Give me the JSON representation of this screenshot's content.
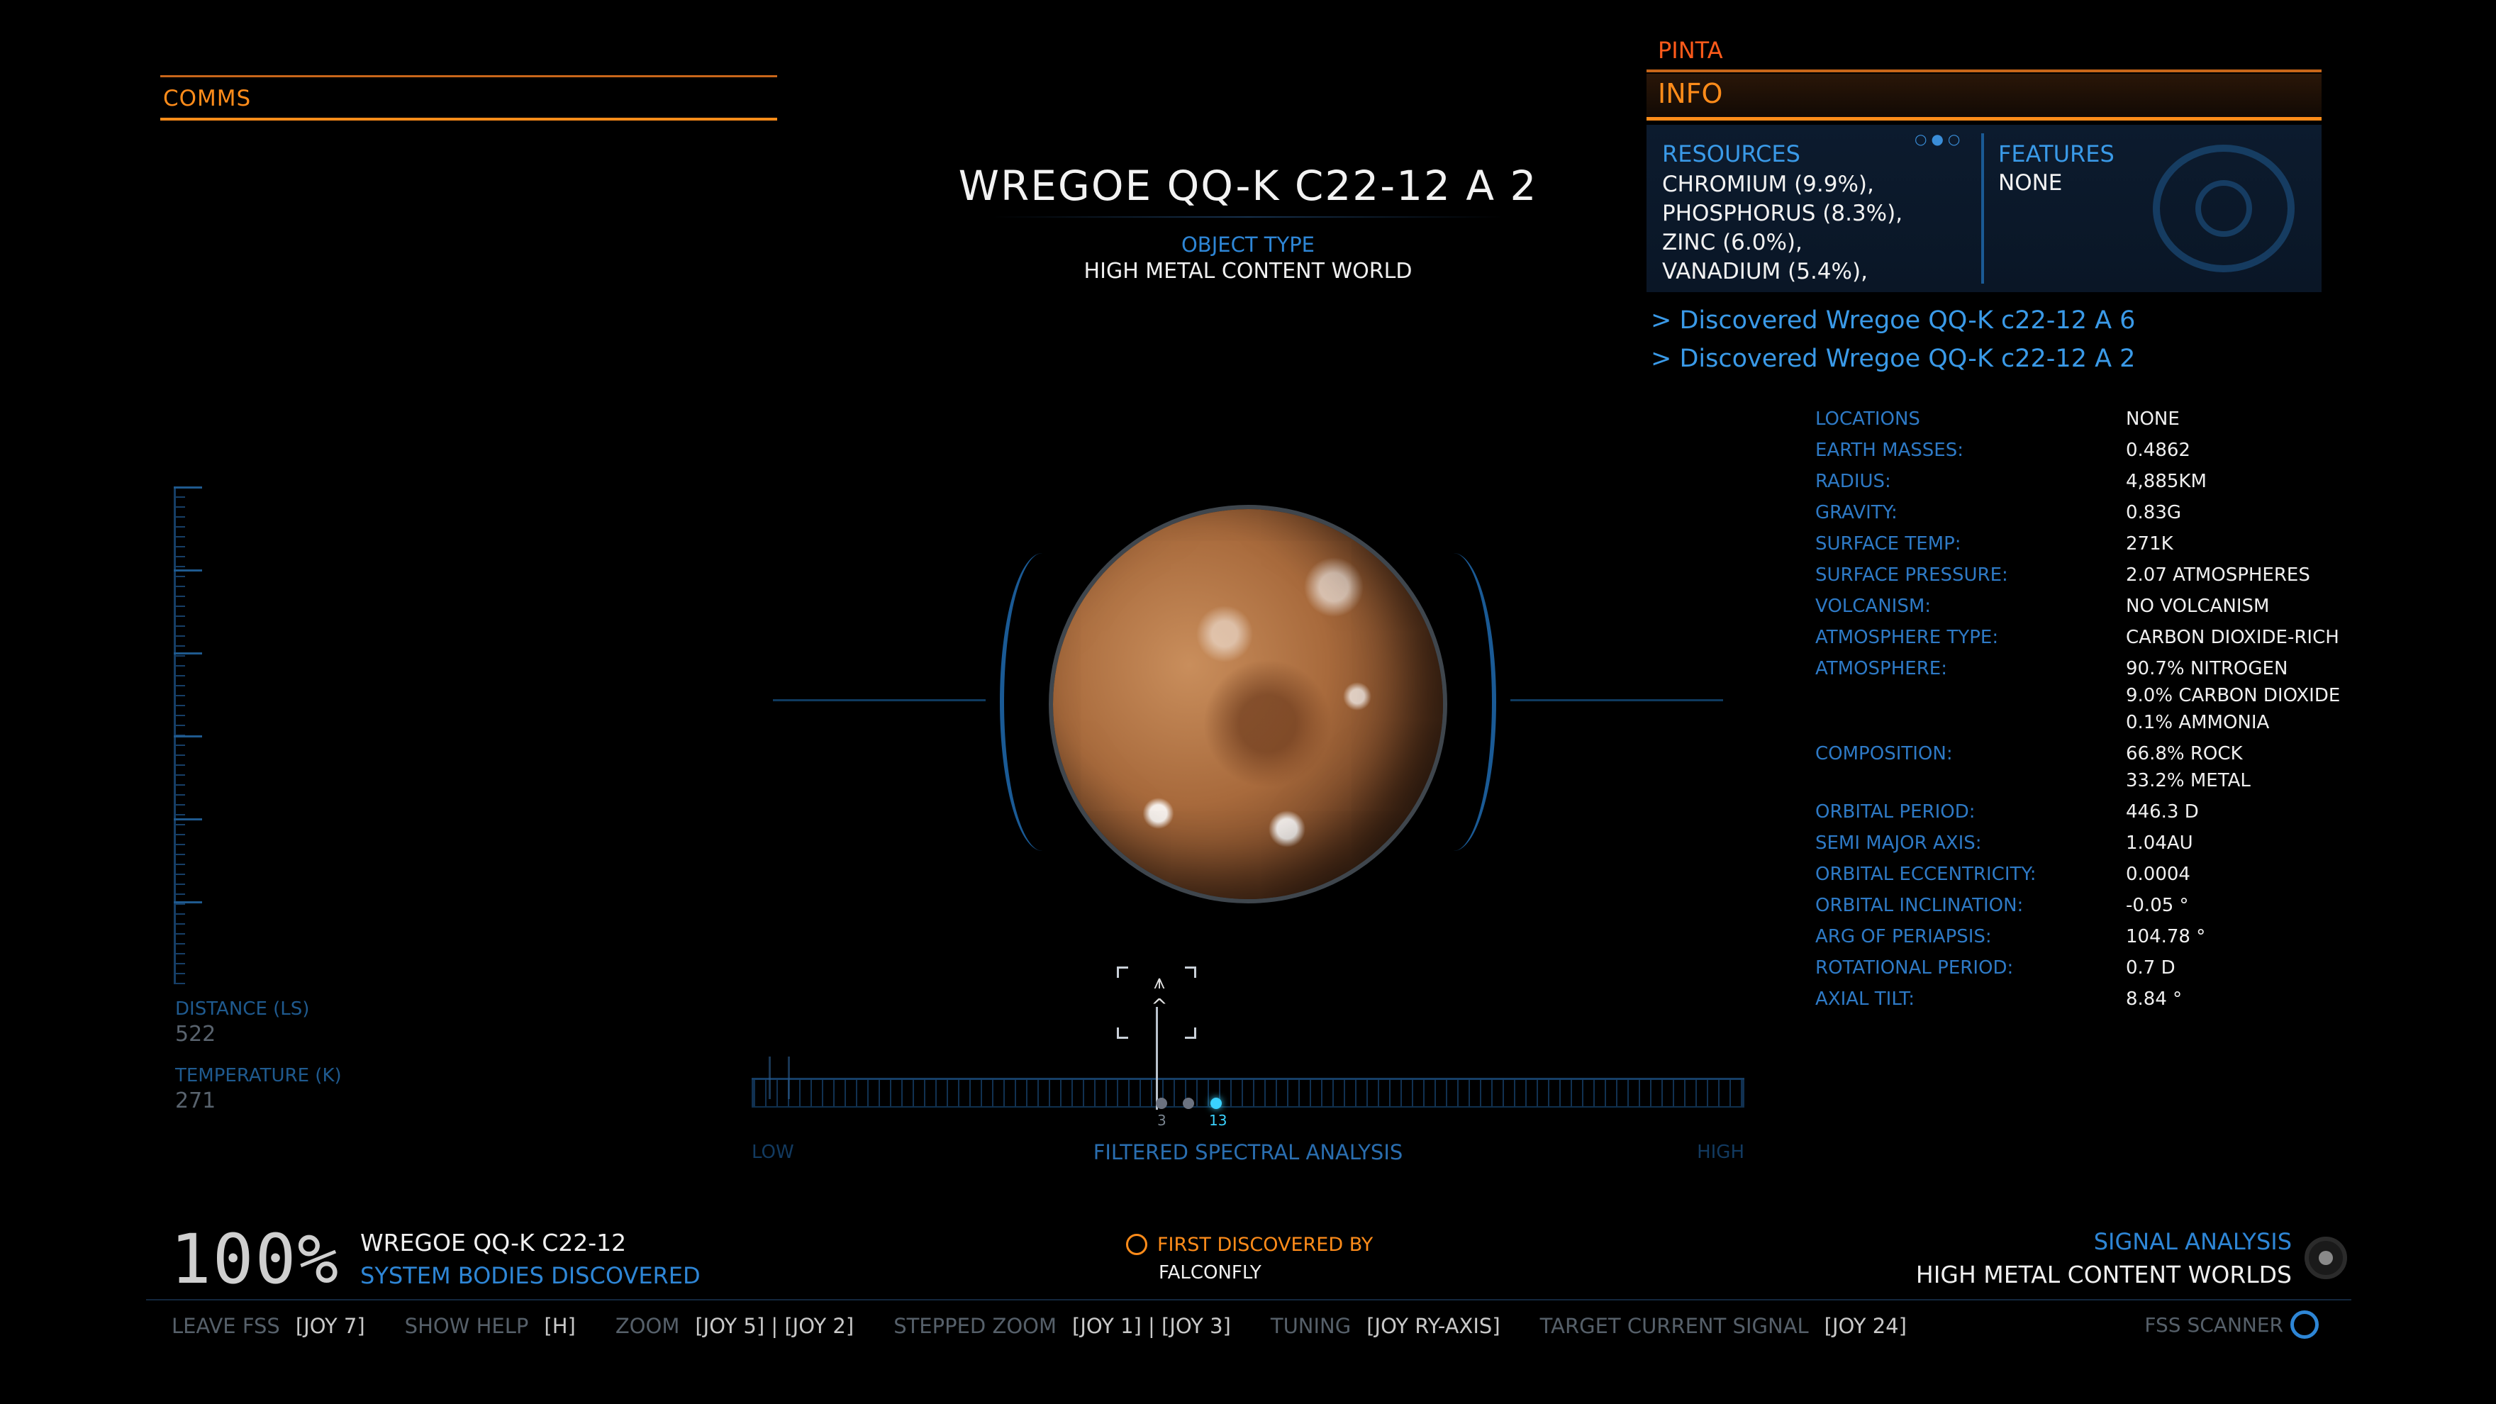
{
  "comms": {
    "label": "COMMS"
  },
  "body": {
    "name": "WREGOE QQ-K C22-12 A 2",
    "object_type_label": "OBJECT TYPE",
    "object_type_value": "HIGH METAL CONTENT WORLD"
  },
  "left_readouts": {
    "distance_label": "DISTANCE (LS)",
    "distance_value": "522",
    "temperature_label": "TEMPERATURE (K)",
    "temperature_value": "271"
  },
  "spectral": {
    "low": "LOW",
    "high": "HIGH",
    "title": "FILTERED SPECTRAL ANALYSIS",
    "signal_numbers": [
      "3",
      "13"
    ]
  },
  "system": {
    "percent": "100%",
    "name": "WREGOE QQ-K C22-12",
    "sub": "SYSTEM BODIES DISCOVERED"
  },
  "first_discovered": {
    "label": "FIRST DISCOVERED BY",
    "name": "FALCONFLY"
  },
  "signal_analysis": {
    "label": "SIGNAL ANALYSIS",
    "value": "HIGH METAL CONTENT WORLDS"
  },
  "keybinds": [
    {
      "label": "LEAVE FSS",
      "key": "[JOY 7]"
    },
    {
      "label": "SHOW HELP",
      "key": "[H]"
    },
    {
      "label": "ZOOM",
      "key": "[JOY 5] | [JOY 2]"
    },
    {
      "label": "STEPPED ZOOM",
      "key": "[JOY 1] | [JOY 3]"
    },
    {
      "label": "TUNING",
      "key": "[JOY RY-AXIS]"
    },
    {
      "label": "TARGET CURRENT SIGNAL",
      "key": "[JOY 24]"
    }
  ],
  "fss_scanner": "FSS SCANNER",
  "info_panel": {
    "header": "PINTA",
    "tab": "INFO",
    "resources_title": "RESOURCES",
    "resources": [
      "CHROMIUM (9.9%),",
      "PHOSPHORUS (8.3%),",
      "ZINC (6.0%),",
      "VANADIUM (5.4%),"
    ],
    "features_title": "FEATURES",
    "features_value": "NONE",
    "page_dots": "○●○"
  },
  "discoveries": [
    "> Discovered Wregoe QQ-K c22-12 A 6",
    "> Discovered Wregoe QQ-K c22-12 A 2"
  ],
  "properties": [
    {
      "label": "LOCATIONS",
      "value": "NONE"
    },
    {
      "label": "EARTH MASSES:",
      "value": "0.4862"
    },
    {
      "label": "RADIUS:",
      "value": "4,885KM"
    },
    {
      "label": "GRAVITY:",
      "value": "0.83G"
    },
    {
      "label": "SURFACE TEMP:",
      "value": "271K"
    },
    {
      "label": "SURFACE PRESSURE:",
      "value": "2.07 ATMOSPHERES"
    },
    {
      "label": "VOLCANISM:",
      "value": "NO VOLCANISM"
    },
    {
      "label": "ATMOSPHERE TYPE:",
      "value": "CARBON DIOXIDE-RICH"
    },
    {
      "label": "ATMOSPHERE:",
      "value": "90.7% NITROGEN\n9.0% CARBON DIOXIDE\n0.1% AMMONIA"
    },
    {
      "label": "COMPOSITION:",
      "value": "66.8% ROCK\n33.2% METAL"
    },
    {
      "label": "ORBITAL PERIOD:",
      "value": "446.3 D"
    },
    {
      "label": "SEMI MAJOR AXIS:",
      "value": "1.04AU"
    },
    {
      "label": "ORBITAL ECCENTRICITY:",
      "value": "0.0004"
    },
    {
      "label": "ORBITAL INCLINATION:",
      "value": "-0.05 °"
    },
    {
      "label": "ARG OF PERIAPSIS:",
      "value": "104.78 °"
    },
    {
      "label": "ROTATIONAL PERIOD:",
      "value": "0.7 D"
    },
    {
      "label": "AXIAL TILT:",
      "value": "8.84 °"
    }
  ],
  "colors": {
    "accent_orange": "#ff8c1a",
    "accent_blue": "#3a8dd8",
    "signal_cyan": "#3ad2ff"
  }
}
